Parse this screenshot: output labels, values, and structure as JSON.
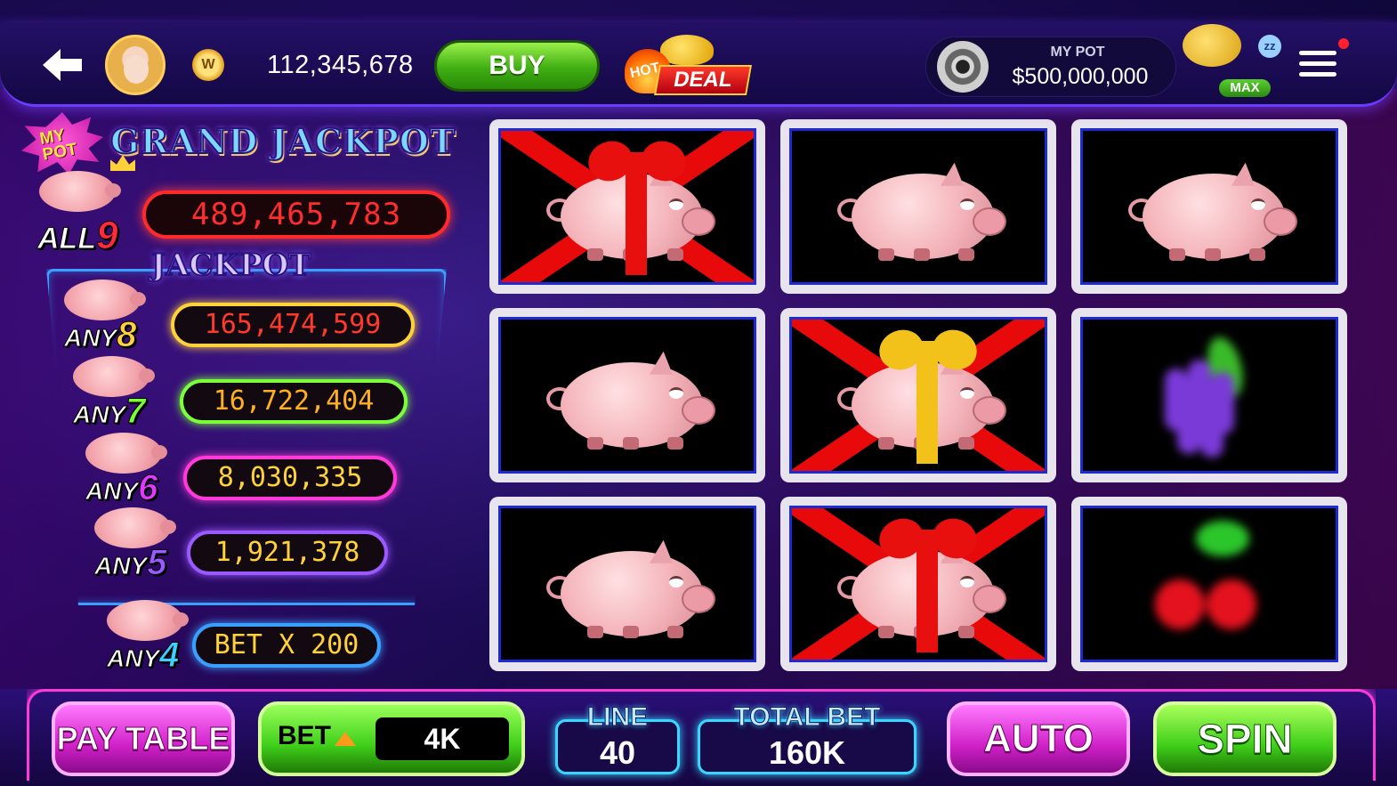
{
  "top_bar": {
    "balance": "112,345,678",
    "coin_symbol": "W",
    "buy_label": "BUY",
    "hot_deal": {
      "hot": "HOT",
      "deal": "DEAL"
    },
    "my_pot": {
      "label": "MY POT",
      "value": "$500,000,000"
    },
    "piggy": {
      "max_label": "MAX",
      "sleep_label": "zz"
    },
    "icons": [
      "back-arrow-icon",
      "avatar",
      "coin-icon",
      "safe-icon",
      "piggy-bank-icon",
      "menu-icon"
    ]
  },
  "jackpots": {
    "badge": "MY POT",
    "grand_title": "GRAND JACKPOT",
    "grand": {
      "label_prefix": "ALL",
      "label_num": "9",
      "value": "489,465,783",
      "color": "#ff2a2a"
    },
    "jackpot_title": "JACKPOT",
    "tiers": [
      {
        "label_prefix": "ANY",
        "label_num": "8",
        "value": "165,474,599",
        "border": "#ffd23a",
        "num_color": "#ffd23a",
        "text": "#ff3a2a"
      },
      {
        "label_prefix": "ANY",
        "label_num": "7",
        "value": "16,722,404",
        "border": "#7aff3a",
        "num_color": "#7aff3a",
        "text": "#ffb020"
      },
      {
        "label_prefix": "ANY",
        "label_num": "6",
        "value": "8,030,335",
        "border": "#ff3ad8",
        "num_color": "#e03aff",
        "text": "#ffd23a"
      },
      {
        "label_prefix": "ANY",
        "label_num": "5",
        "value": "1,921,378",
        "border": "#9a5aff",
        "num_color": "#9a5aff",
        "text": "#ffd23a"
      },
      {
        "label_prefix": "ANY",
        "label_num": "4",
        "value": "BET X 200",
        "border": "#3aa0ff",
        "num_color": "#3ad0ff",
        "text": "#ffd23a"
      }
    ]
  },
  "reels": [
    [
      {
        "symbol": "pig",
        "bow": "red"
      },
      {
        "symbol": "pig",
        "bow": "none"
      },
      {
        "symbol": "pig",
        "bow": "none"
      }
    ],
    [
      {
        "symbol": "pig",
        "bow": "none"
      },
      {
        "symbol": "pig",
        "bow": "gold"
      },
      {
        "symbol": "pig",
        "bow": "red"
      }
    ],
    [
      {
        "symbol": "pig",
        "bow": "none"
      },
      {
        "symbol": "grapes",
        "bow": "none"
      },
      {
        "symbol": "cherries",
        "bow": "none"
      }
    ]
  ],
  "bottom_bar": {
    "pay_table": "PAY TABLE",
    "bet_label": "BET",
    "bet_value": "4K",
    "line_label": "LINE",
    "line_value": "40",
    "total_bet_label": "TOTAL BET",
    "total_bet_value": "160K",
    "auto": "AUTO",
    "spin": "SPIN"
  },
  "colors": {
    "accent_pink": "#ff3ad8",
    "accent_green": "#3fcf1a",
    "panel_blue": "#1e2bd0"
  }
}
